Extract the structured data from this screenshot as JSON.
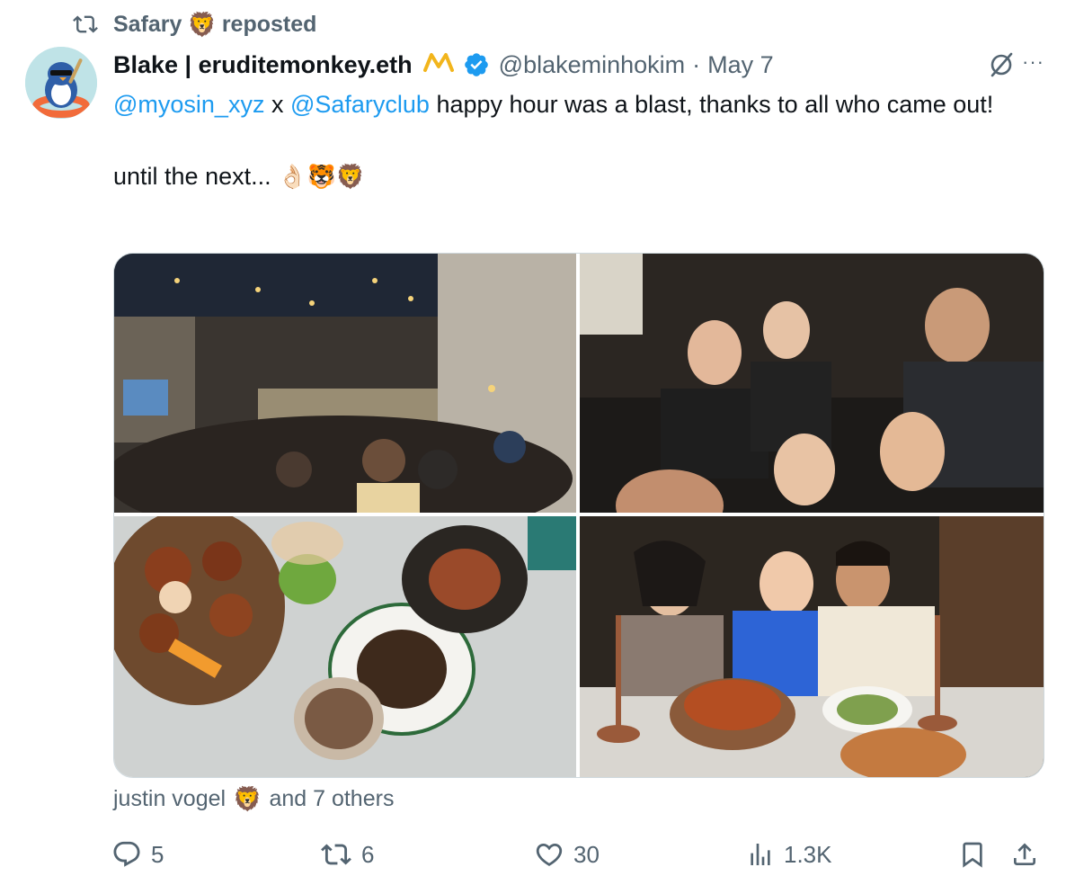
{
  "repost": {
    "user": "Safary",
    "emoji": "🦁",
    "suffix": "reposted"
  },
  "author": {
    "name": "Blake | eruditemonkey.eth",
    "badge_icon": "m-badge-icon",
    "handle": "@blakeminhokim",
    "separator": "·",
    "date": "May 7",
    "more": "···"
  },
  "tweet": {
    "mention1": "@myosin_xyz",
    "joiner": " x ",
    "mention2": "@Safaryclub",
    "line1_rest": " happy hour was a blast, thanks to all who came out!",
    "line2": "until the next...",
    "line2_emojis": "👌🏻🐯🦁"
  },
  "media": [
    {
      "alt": "photo-bar-crowd"
    },
    {
      "alt": "photo-group-selfie"
    },
    {
      "alt": "photo-food-table"
    },
    {
      "alt": "photo-three-friends-dinner"
    }
  ],
  "liked_by": {
    "name": "justin vogel",
    "emoji": "🦁",
    "rest": "and 7 others"
  },
  "actions": {
    "replies": "5",
    "reposts": "6",
    "likes": "30",
    "views": "1.3K"
  },
  "colors": {
    "accent": "#1d9bf0",
    "muted": "#536471",
    "text": "#0f1419",
    "gold": "#f2b51c"
  }
}
